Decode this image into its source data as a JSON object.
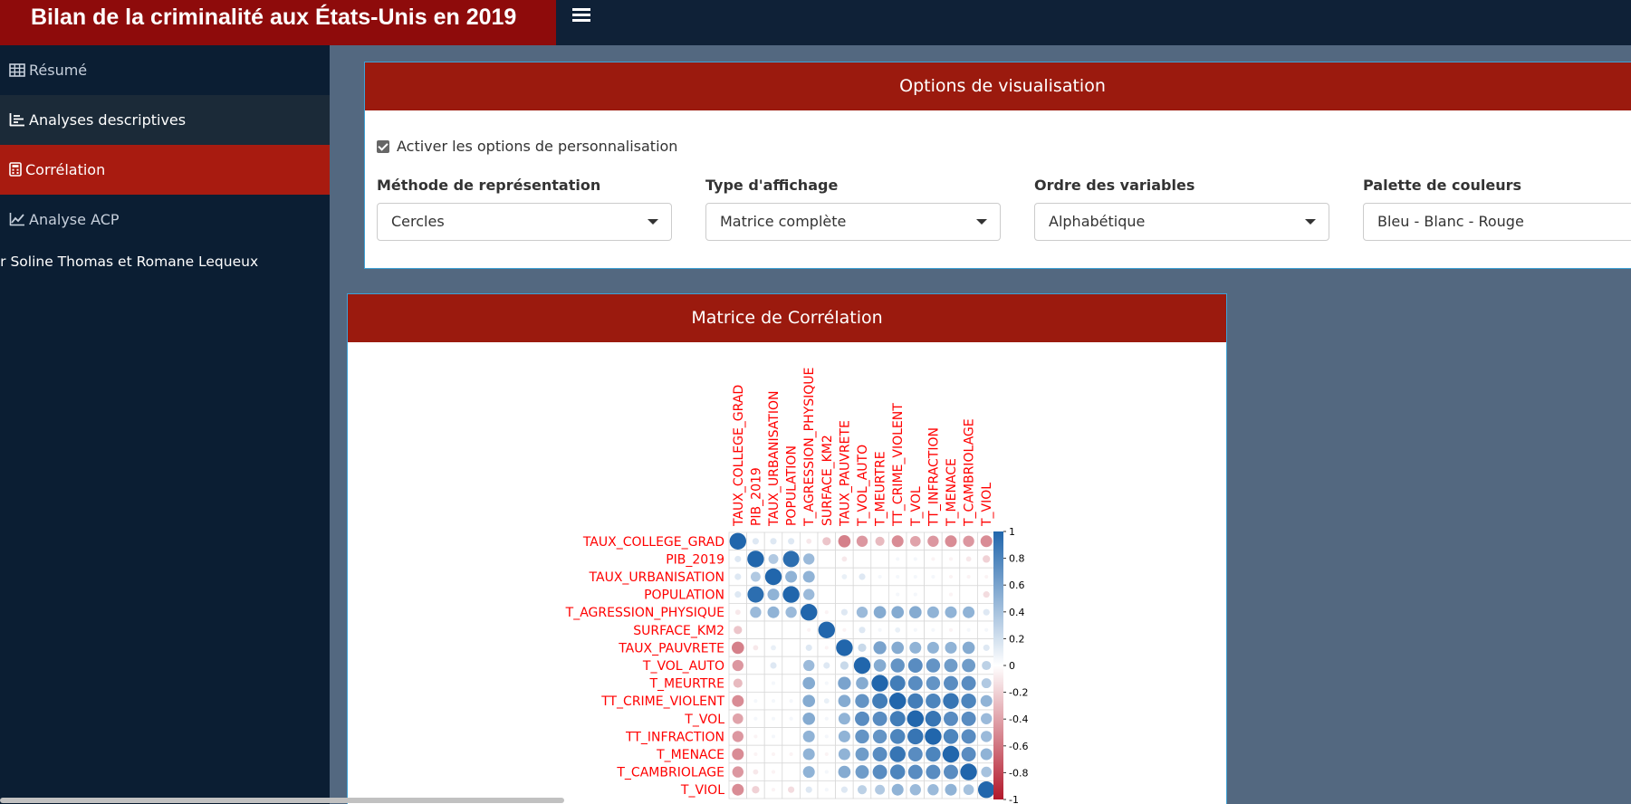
{
  "header": {
    "title": "Bilan de la criminalité aux États-Unis en 2019",
    "menu_icon": "hamburger-icon"
  },
  "sidebar": {
    "items": [
      {
        "label": "Résumé",
        "icon": "table-icon"
      },
      {
        "label": "Analyses descriptives",
        "icon": "bar-list-icon"
      },
      {
        "label": "Corrélation",
        "icon": "calculator-icon"
      },
      {
        "label": "Analyse ACP",
        "icon": "line-chart-icon"
      }
    ],
    "author": "Par Soline Thomas et Romane Lequeux"
  },
  "options": {
    "title": "Options de visualisation",
    "checkbox_label": "Activer les options de personnalisation",
    "checkbox_checked": true,
    "fields": [
      {
        "label": "Méthode de représentation",
        "value": "Cercles"
      },
      {
        "label": "Type d'affichage",
        "value": "Matrice complète"
      },
      {
        "label": "Ordre des variables",
        "value": "Alphabétique"
      },
      {
        "label": "Palette de couleurs",
        "value": "Bleu - Blanc - Rouge"
      }
    ]
  },
  "correlation": {
    "title": "Matrice de Corrélation"
  },
  "chart_data": {
    "type": "heatmap",
    "method": "circle",
    "variables": [
      "TAUX_COLLEGE_GRAD",
      "PIB_2019",
      "TAUX_URBANISATION",
      "POPULATION",
      "T_AGRESSION_PHYSIQUE",
      "SURFACE_KM2",
      "TAUX_PAUVRETE",
      "T_VOL_AUTO",
      "T_MEURTRE",
      "TT_CRIME_VIOLENT",
      "T_VOL",
      "TT_INFRACTION",
      "T_MENACE",
      "T_CAMBRIOLAGE",
      "T_VIOL"
    ],
    "matrix": [
      [
        1,
        0.15,
        0.15,
        0.15,
        -0.1,
        -0.25,
        -0.55,
        -0.45,
        -0.3,
        -0.5,
        -0.4,
        -0.45,
        -0.5,
        -0.45,
        -0.5
      ],
      [
        0.15,
        1,
        0.35,
        0.95,
        0.45,
        0,
        -0.1,
        0,
        0,
        0.05,
        0.05,
        -0.05,
        -0.05,
        -0.1,
        -0.2
      ],
      [
        0.15,
        0.35,
        1,
        0.5,
        0.5,
        0,
        0.1,
        0.15,
        0.05,
        0.05,
        0.05,
        0.05,
        -0.05,
        -0.05,
        -0.05
      ],
      [
        0.15,
        0.95,
        0.5,
        1,
        0.45,
        0,
        0,
        0,
        0,
        0.05,
        0.05,
        0,
        -0.05,
        0,
        -0.15
      ],
      [
        -0.1,
        0.45,
        0.5,
        0.45,
        1,
        -0.05,
        0.15,
        0.45,
        0.55,
        0.55,
        0.55,
        0.5,
        0.5,
        0.5,
        0.15
      ],
      [
        -0.25,
        0,
        0,
        0,
        -0.05,
        1,
        -0.05,
        0.15,
        0.05,
        0.1,
        0.05,
        0.05,
        -0.05,
        0.05,
        0.05
      ],
      [
        -0.55,
        -0.1,
        0.1,
        0,
        0.15,
        -0.05,
        1,
        0.25,
        0.6,
        0.55,
        0.5,
        0.5,
        0.5,
        0.55,
        0.15
      ],
      [
        -0.45,
        0,
        0.15,
        0,
        0.45,
        0.15,
        0.25,
        1,
        0.55,
        0.7,
        0.75,
        0.7,
        0.65,
        0.65,
        0.3
      ],
      [
        -0.3,
        0,
        0.05,
        0,
        0.55,
        0.05,
        0.6,
        0.55,
        1,
        0.85,
        0.75,
        0.7,
        0.75,
        0.75,
        0.35
      ],
      [
        -0.5,
        0.05,
        0.05,
        0.05,
        0.55,
        0.1,
        0.55,
        0.7,
        0.85,
        1,
        0.85,
        0.8,
        0.9,
        0.8,
        0.5
      ],
      [
        -0.4,
        0.05,
        0.05,
        0.05,
        0.55,
        0.05,
        0.5,
        0.75,
        0.75,
        0.85,
        1,
        0.9,
        0.75,
        0.75,
        0.45
      ],
      [
        -0.45,
        -0.05,
        0.05,
        0,
        0.5,
        0.05,
        0.5,
        0.7,
        0.7,
        0.8,
        0.9,
        1,
        0.8,
        0.75,
        0.45
      ],
      [
        -0.5,
        -0.05,
        -0.05,
        -0.05,
        0.5,
        -0.05,
        0.5,
        0.65,
        0.75,
        0.9,
        0.75,
        0.8,
        1,
        0.75,
        0.5
      ],
      [
        -0.45,
        -0.1,
        -0.05,
        0,
        0.5,
        0.05,
        0.55,
        0.65,
        0.75,
        0.8,
        0.75,
        0.75,
        0.75,
        1,
        0.4
      ],
      [
        -0.5,
        -0.2,
        -0.05,
        -0.15,
        0.15,
        0.05,
        0.15,
        0.3,
        0.35,
        0.5,
        0.45,
        0.45,
        0.5,
        0.4,
        1
      ]
    ],
    "legend_ticks": [
      "1",
      "0.8",
      "0.6",
      "0.4",
      "0.2",
      "0",
      "-0.2",
      "-0.4",
      "-0.6",
      "-0.8",
      "-1"
    ],
    "range": [
      -1,
      1
    ],
    "colors": {
      "neg": "#b2182b",
      "mid": "#ffffff",
      "pos": "#2166ac",
      "label": "#ff0000"
    }
  }
}
